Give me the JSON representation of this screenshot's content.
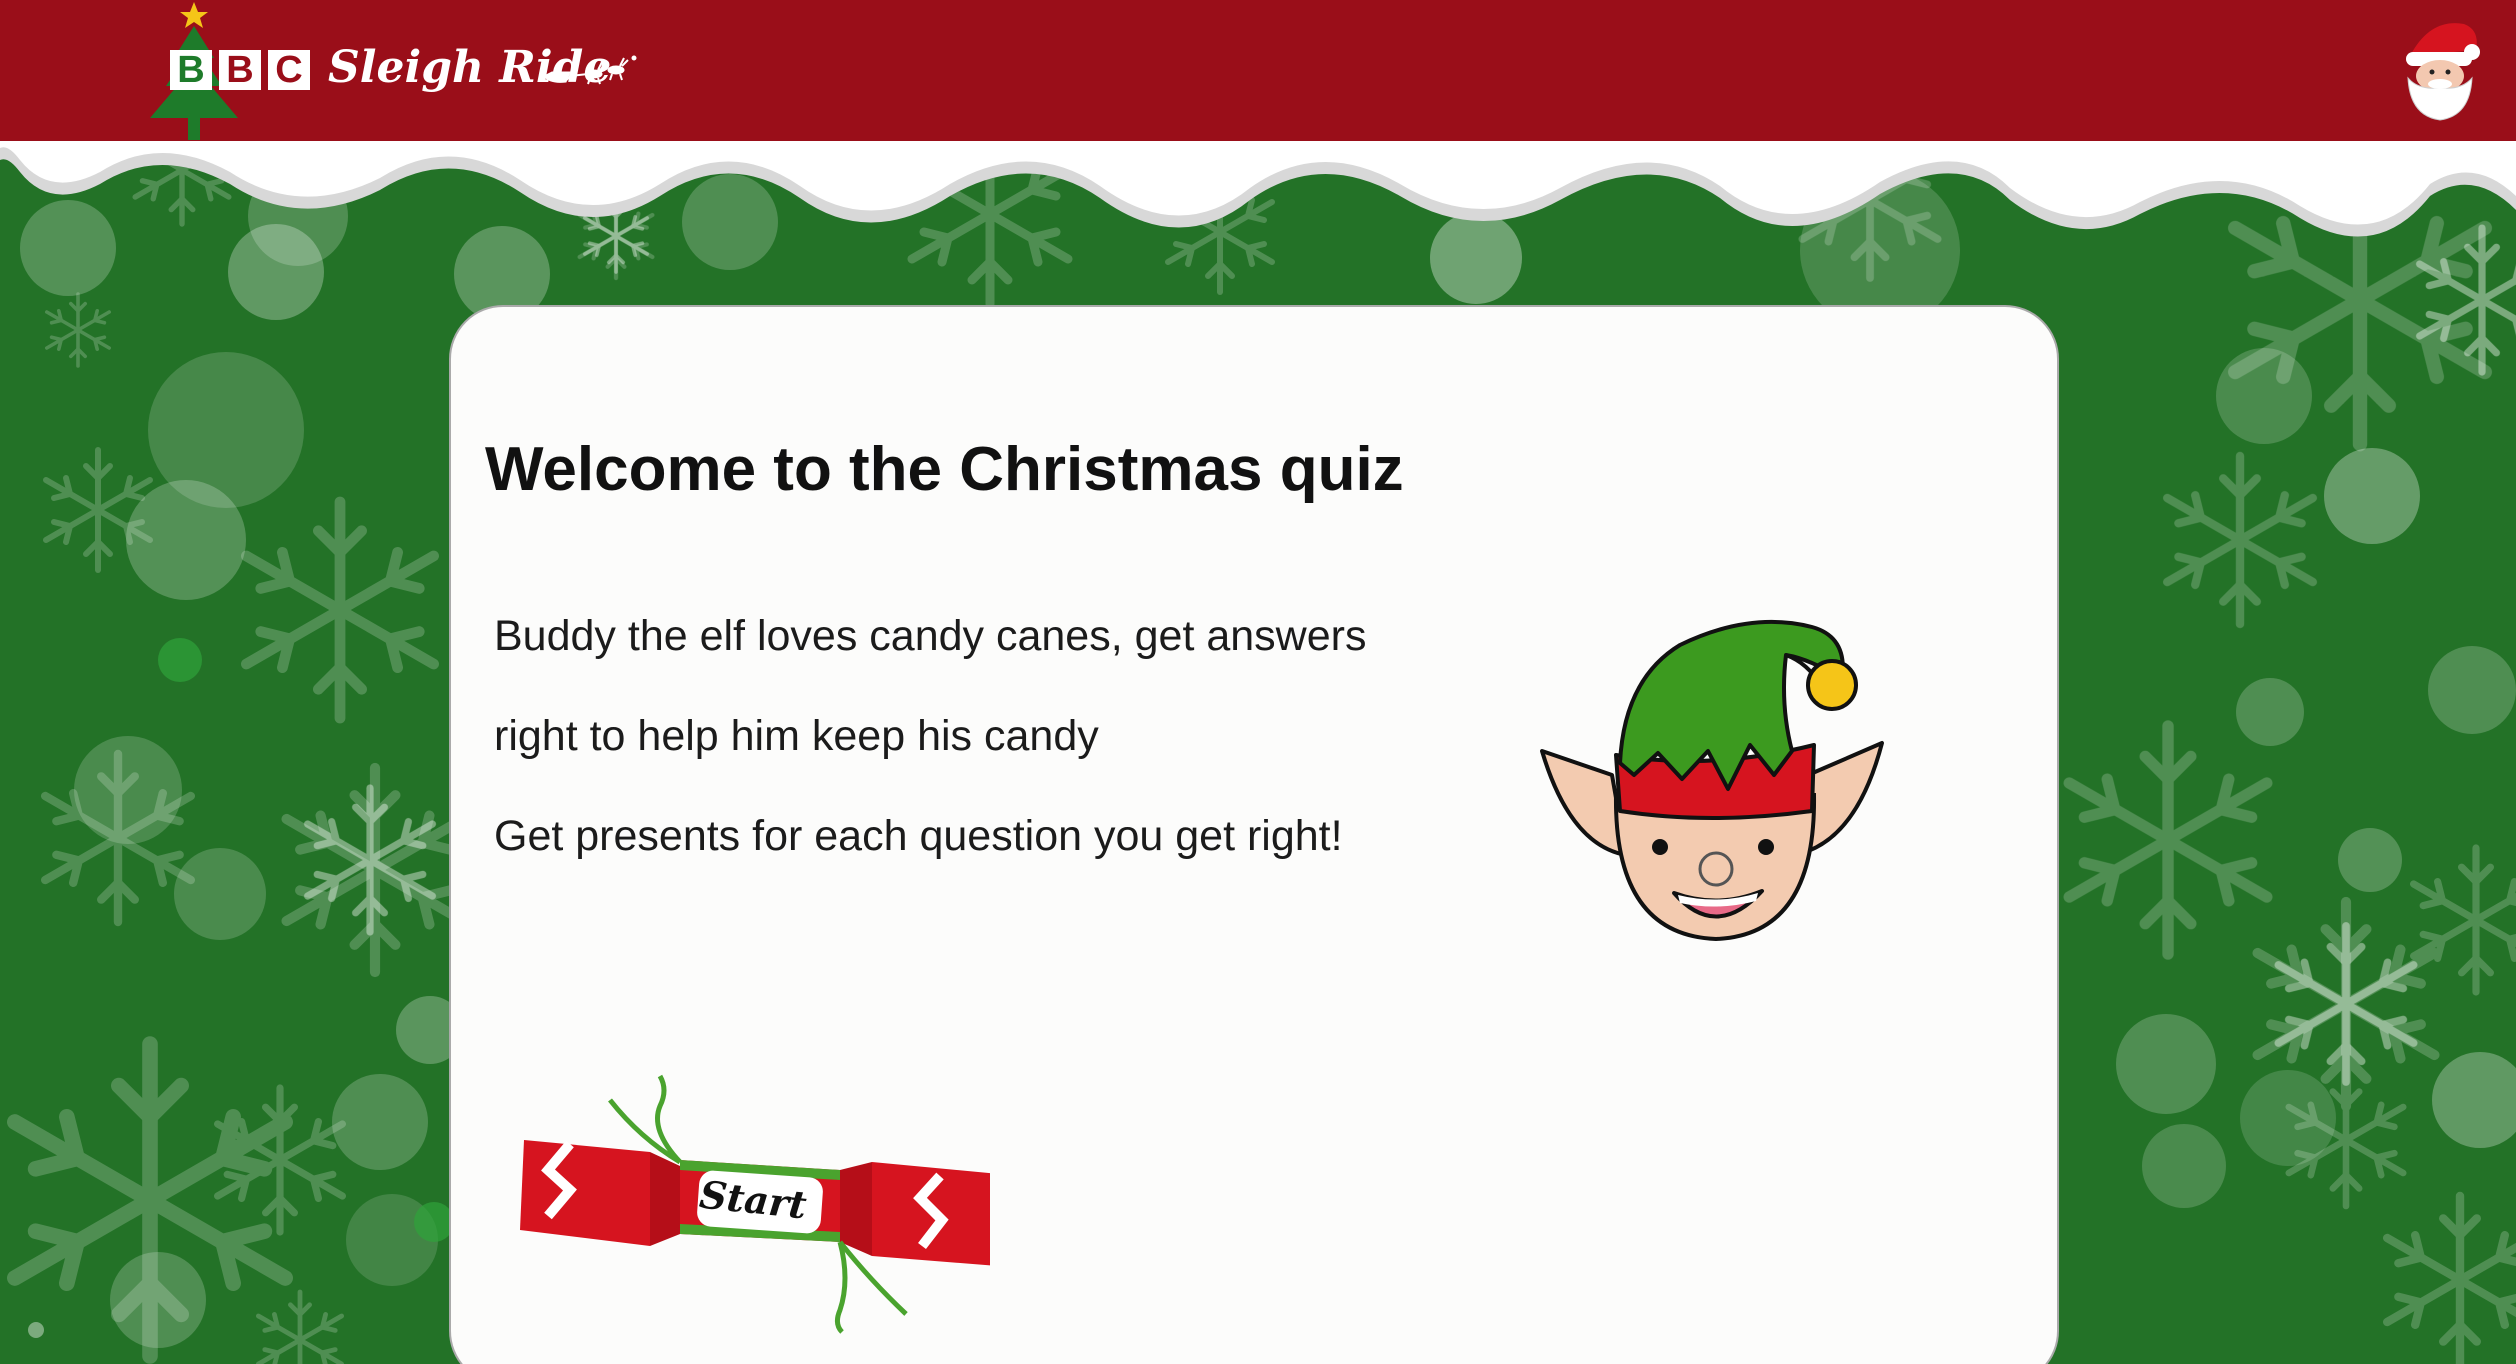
{
  "header": {
    "brand_letters": [
      "B",
      "B",
      "C"
    ],
    "brand_name": "Sleigh Ride"
  },
  "main": {
    "title": "Welcome to the Christmas quiz",
    "lines": [
      "Buddy the elf loves candy canes, get answers",
      "right to help him keep his candy",
      "Get presents for each question you get right!"
    ],
    "start_label": "Start"
  },
  "colors": {
    "header_red": "#9a0e19",
    "background_green": "#1f6e24",
    "card": "#fcfcfb",
    "cracker_red": "#d6141f",
    "ribbon_green": "#4aa32e"
  },
  "icons": {
    "tree": "christmas-tree-icon",
    "sleigh": "reindeer-sleigh-icon",
    "santa": "santa-face-icon",
    "elf": "elf-head-illustration",
    "cracker": "christmas-cracker-icon"
  }
}
